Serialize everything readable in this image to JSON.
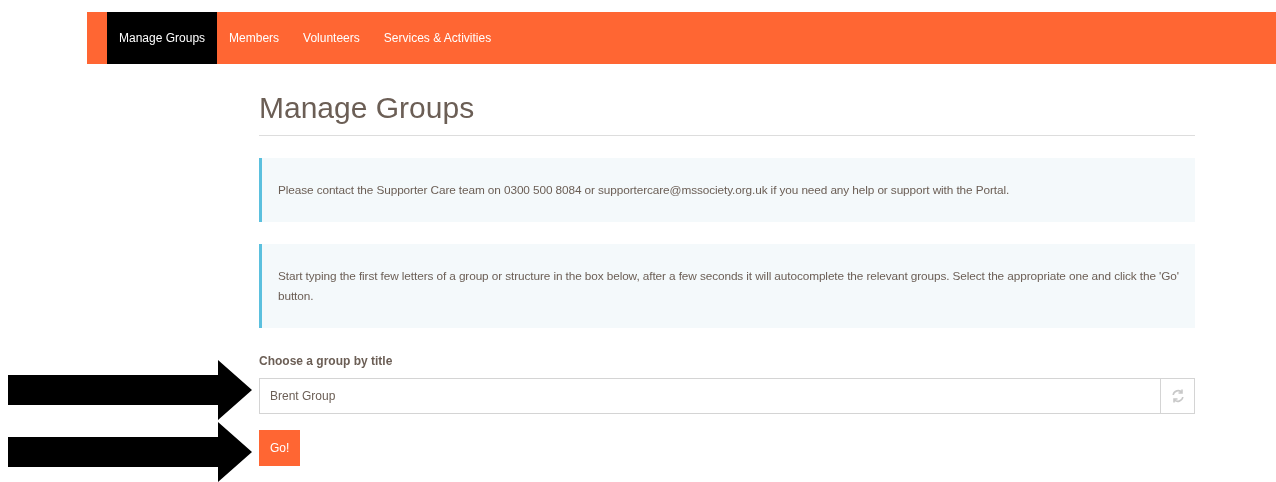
{
  "nav": {
    "items": [
      {
        "label": "Manage Groups",
        "selected": true
      },
      {
        "label": "Members",
        "selected": false
      },
      {
        "label": "Volunteers",
        "selected": false
      },
      {
        "label": "Services & Activities",
        "selected": false
      }
    ]
  },
  "page_title": "Manage Groups",
  "alerts": [
    "Please contact the Supporter Care team on 0300 500 8084 or supportercare@mssociety.org.uk if you need any help or support with the Portal.",
    "Start typing the first few letters of a group or structure in the box below, after a few seconds it will autocomplete the relevant groups. Select the appropriate one and click the 'Go' button."
  ],
  "group_field": {
    "label": "Choose a group by title",
    "value": "Brent Group"
  },
  "go_button": "Go!",
  "annotations": [
    {
      "kind": "arrow"
    },
    {
      "kind": "arrow"
    }
  ]
}
